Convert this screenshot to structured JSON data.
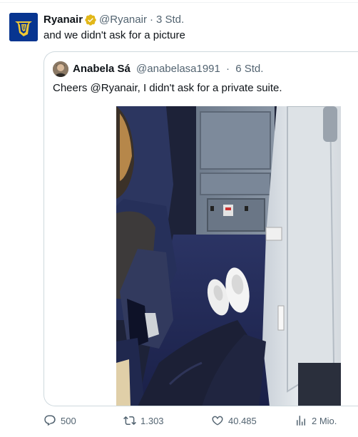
{
  "tweet": {
    "author_name": "Ryanair",
    "author_handle": "@Ryanair",
    "separator": "·",
    "time": "3 Std.",
    "text": "and we didn't ask for a picture",
    "avatar_icon": "ryanair-harp-logo-icon",
    "verified_icon": "gold-verified-badge-icon"
  },
  "quoted_tweet": {
    "author_name": "Anabela Sá",
    "author_handle": "@anabelasa1991",
    "separator": "·",
    "time": "6 Std.",
    "text": "Cheers @Ryanair, I didn't ask for a private suite."
  },
  "actions": {
    "replies": {
      "icon": "reply-icon",
      "count": "500"
    },
    "reposts": {
      "icon": "repost-icon",
      "count": "1.303"
    },
    "likes": {
      "icon": "heart-icon",
      "count": "40.485"
    },
    "views": {
      "icon": "views-bar-chart-icon",
      "count": "2 Mio."
    }
  },
  "colors": {
    "text_primary": "#0f1419",
    "text_secondary": "#536471",
    "border": "#cfd9de",
    "ryanair_blue": "#073590",
    "ryanair_gold": "#f1c933"
  }
}
